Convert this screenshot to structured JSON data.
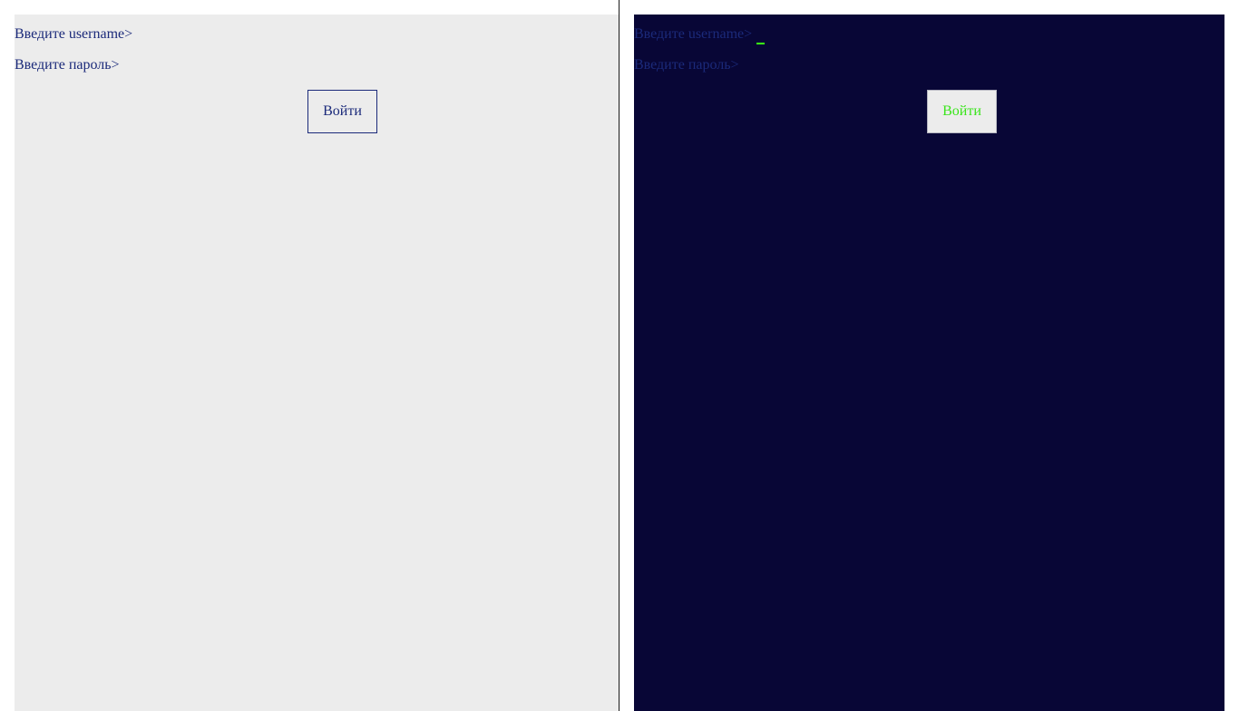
{
  "colors": {
    "light_panel_bg": "#ececec",
    "dark_panel_bg": "#080636",
    "prompt_text": "#1b2a7a",
    "accent_green": "#39ff14"
  },
  "light_panel": {
    "username_prompt": "Введите username>",
    "username_value": "",
    "password_prompt": "Введите пароль>",
    "password_value": "",
    "login_button": "Войти"
  },
  "dark_panel": {
    "username_prompt": "Введите username>",
    "username_value": "",
    "password_prompt": "Введите пароль>",
    "password_value": "",
    "login_button": "Войти"
  }
}
